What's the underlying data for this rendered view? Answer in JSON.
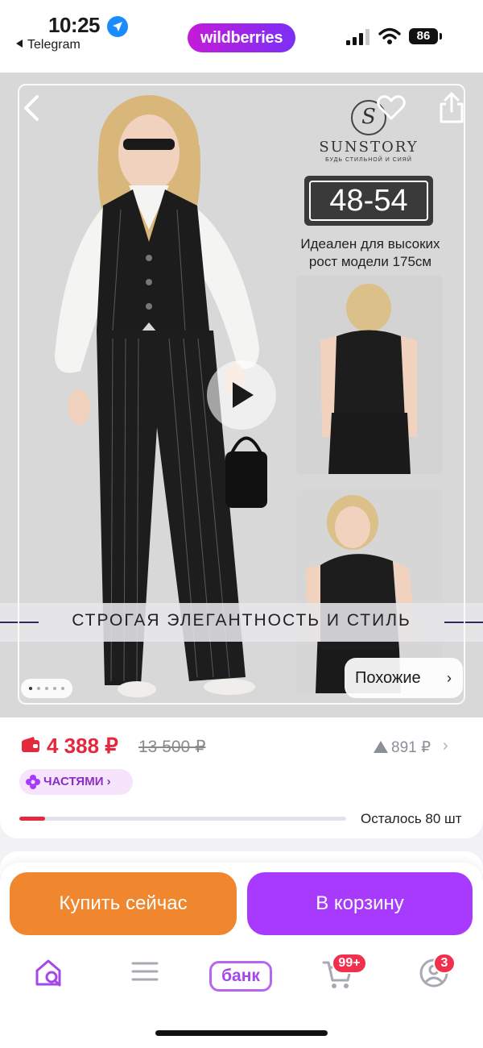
{
  "status_bar": {
    "time": "10:25",
    "back_app": "Telegram",
    "battery": "86"
  },
  "header": {
    "logo": "wildberries"
  },
  "gallery": {
    "brand_name": "SUNSTORY",
    "brand_tagline": "БУДЬ СТИЛЬНОЙ И СИЯЙ",
    "size_range": "48-54",
    "ideal_line1": "Идеален для высоких",
    "ideal_line2": "рост модели 175см",
    "slogan": "СТРОГАЯ ЭЛЕГАНТНОСТЬ И СТИЛЬ",
    "similar_label": "Похожие",
    "slide_count": 5,
    "active_slide": 1,
    "icons": [
      "back-icon",
      "heart-icon",
      "share-icon",
      "play-icon"
    ]
  },
  "price": {
    "current": "4 388 ₽",
    "old": "13 500 ₽",
    "rating_value": "891 ₽",
    "installments_label": "ЧАСТЯМИ",
    "stock_text": "Осталось 80 шт",
    "stock_fraction": 0.08
  },
  "actions": {
    "buy_now": "Купить сейчас",
    "add_to_cart": "В корзину"
  },
  "tabbar": {
    "bank_label": "банк",
    "cart_badge": "99+",
    "profile_badge": "3"
  },
  "colors": {
    "accent_purple": "#a73afd",
    "buy_orange": "#f0872f",
    "price_red": "#e6283f"
  }
}
